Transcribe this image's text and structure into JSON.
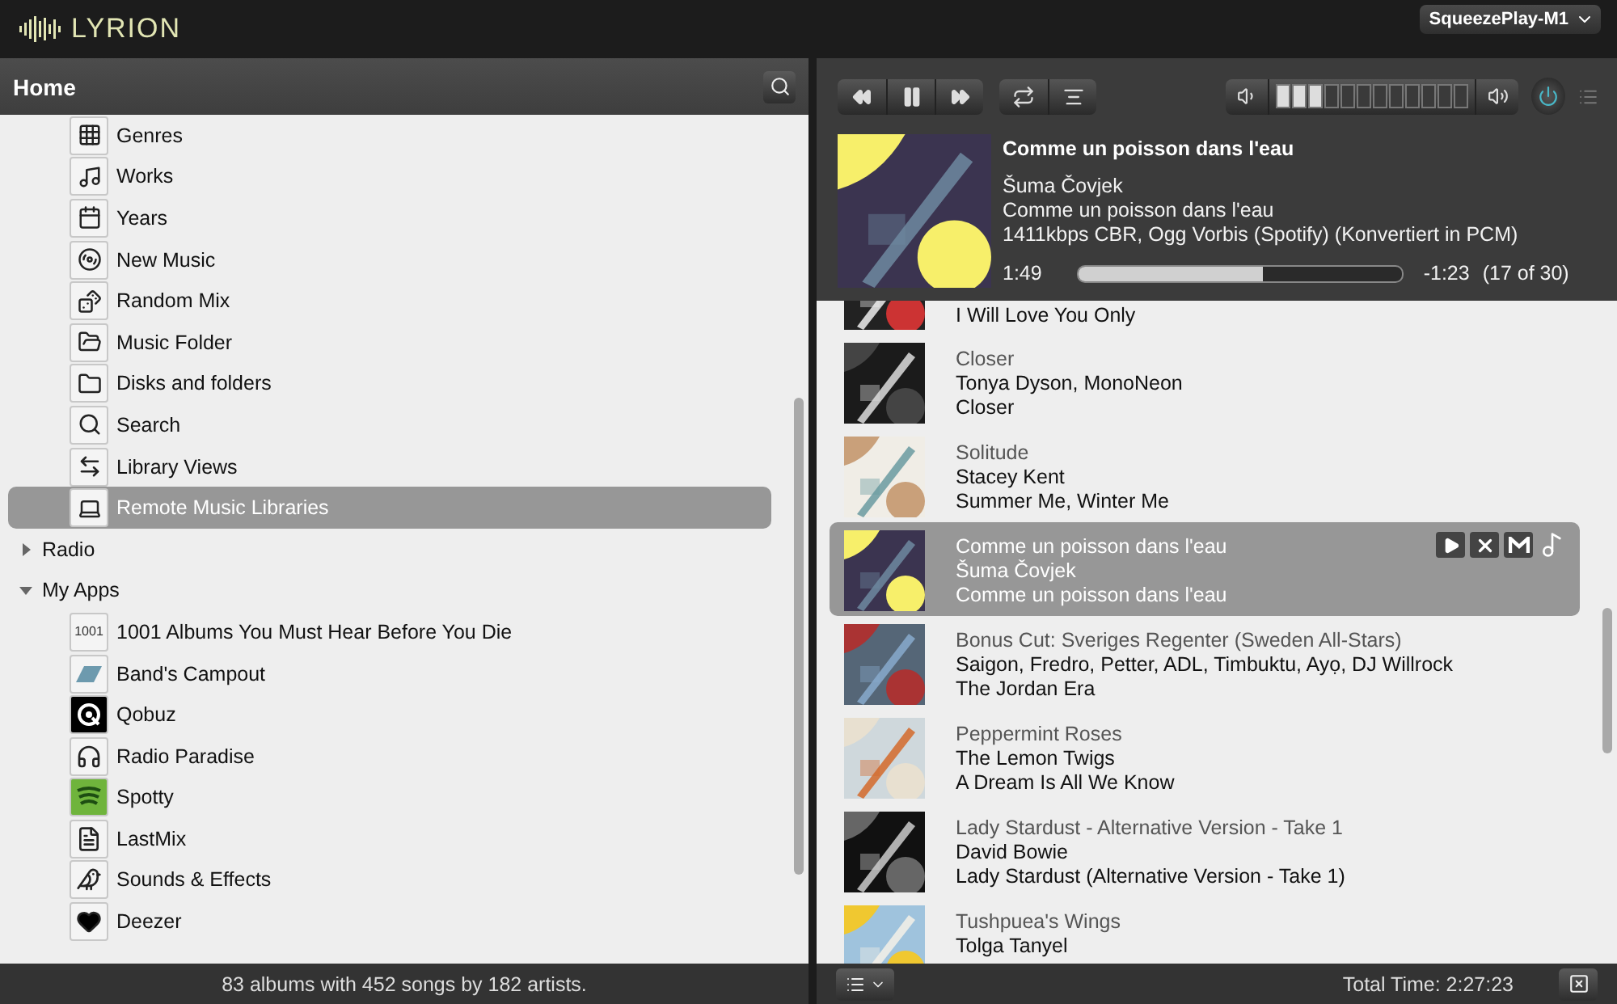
{
  "top_bar": {
    "logo": "LYRION",
    "player_select": "SqueezePlay-M1"
  },
  "browser": {
    "title": "Home",
    "music_items": [
      {
        "label": "Genres",
        "selected": false
      },
      {
        "label": "Works",
        "selected": false
      },
      {
        "label": "Years",
        "selected": false
      },
      {
        "label": "New Music",
        "selected": false
      },
      {
        "label": "Random Mix",
        "selected": false
      },
      {
        "label": "Music Folder",
        "selected": false
      },
      {
        "label": "Disks and folders",
        "selected": false
      },
      {
        "label": "Search",
        "selected": false
      },
      {
        "label": "Library Views",
        "selected": false
      },
      {
        "label": "Remote Music Libraries",
        "selected": true
      }
    ],
    "folders": [
      {
        "label": "Radio",
        "expanded": false
      },
      {
        "label": "My Apps",
        "expanded": true,
        "children": [
          {
            "label": "1001 Albums You Must Hear Before You Die",
            "icon_text": "1001",
            "selected": false
          },
          {
            "label": "Band's Campout",
            "selected": false
          },
          {
            "label": "Qobuz",
            "selected": false
          },
          {
            "label": "Radio Paradise",
            "selected": false
          },
          {
            "label": "Spotty",
            "selected": false
          },
          {
            "label": "LastMix",
            "selected": false
          },
          {
            "label": "Sounds & Effects",
            "selected": false
          },
          {
            "label": "Deezer",
            "selected": false
          }
        ]
      }
    ],
    "status": "83 albums with 452 songs by 182 artists."
  },
  "player": {
    "volume": {
      "level": 0.25
    },
    "power_on": true,
    "now_playing": {
      "title": "Comme un poisson dans l'eau",
      "artist": "Šuma Čovjek",
      "album": "Comme un poisson dans l'eau",
      "format": "1411kbps CBR, Ogg Vorbis (Spotify) (Konvertiert in PCM)",
      "elapsed": "1:49",
      "progress": {
        "level": 0.57
      },
      "remaining": "-1:23",
      "position": "(17 of 30)"
    }
  },
  "playlist": {
    "tracks": [
      {
        "album": "I Will Love You Only",
        "selected": false
      },
      {
        "title": "Closer",
        "artist": "Tonya Dyson, MonoNeon",
        "album": "Closer",
        "selected": false
      },
      {
        "title": "Solitude",
        "artist": "Stacey Kent",
        "album": "Summer Me, Winter Me",
        "selected": false
      },
      {
        "title": "Comme un poisson dans l'eau",
        "artist": "Šuma Čovjek",
        "album": "Comme un poisson dans l'eau",
        "selected": true
      },
      {
        "title": "Bonus Cut: Sveriges Regenter (Sweden All-Stars)",
        "artist": "Saigon, Fredro, Petter, ADL, Timbuktu, Ayọ, DJ Willrock",
        "album": "The Jordan Era",
        "selected": false
      },
      {
        "title": "Peppermint Roses",
        "artist": "The Lemon Twigs",
        "album": "A Dream Is All We Know",
        "selected": false
      },
      {
        "title": "Lady Stardust - Alternative Version - Take 1",
        "artist": "David Bowie",
        "album": "Lady Stardust (Alternative Version - Take 1)",
        "selected": false
      },
      {
        "title": "Tushpuea's Wings",
        "artist": "Tolga Tanyel",
        "selected": false
      }
    ],
    "total_time": "Total Time: 2:27:23"
  }
}
